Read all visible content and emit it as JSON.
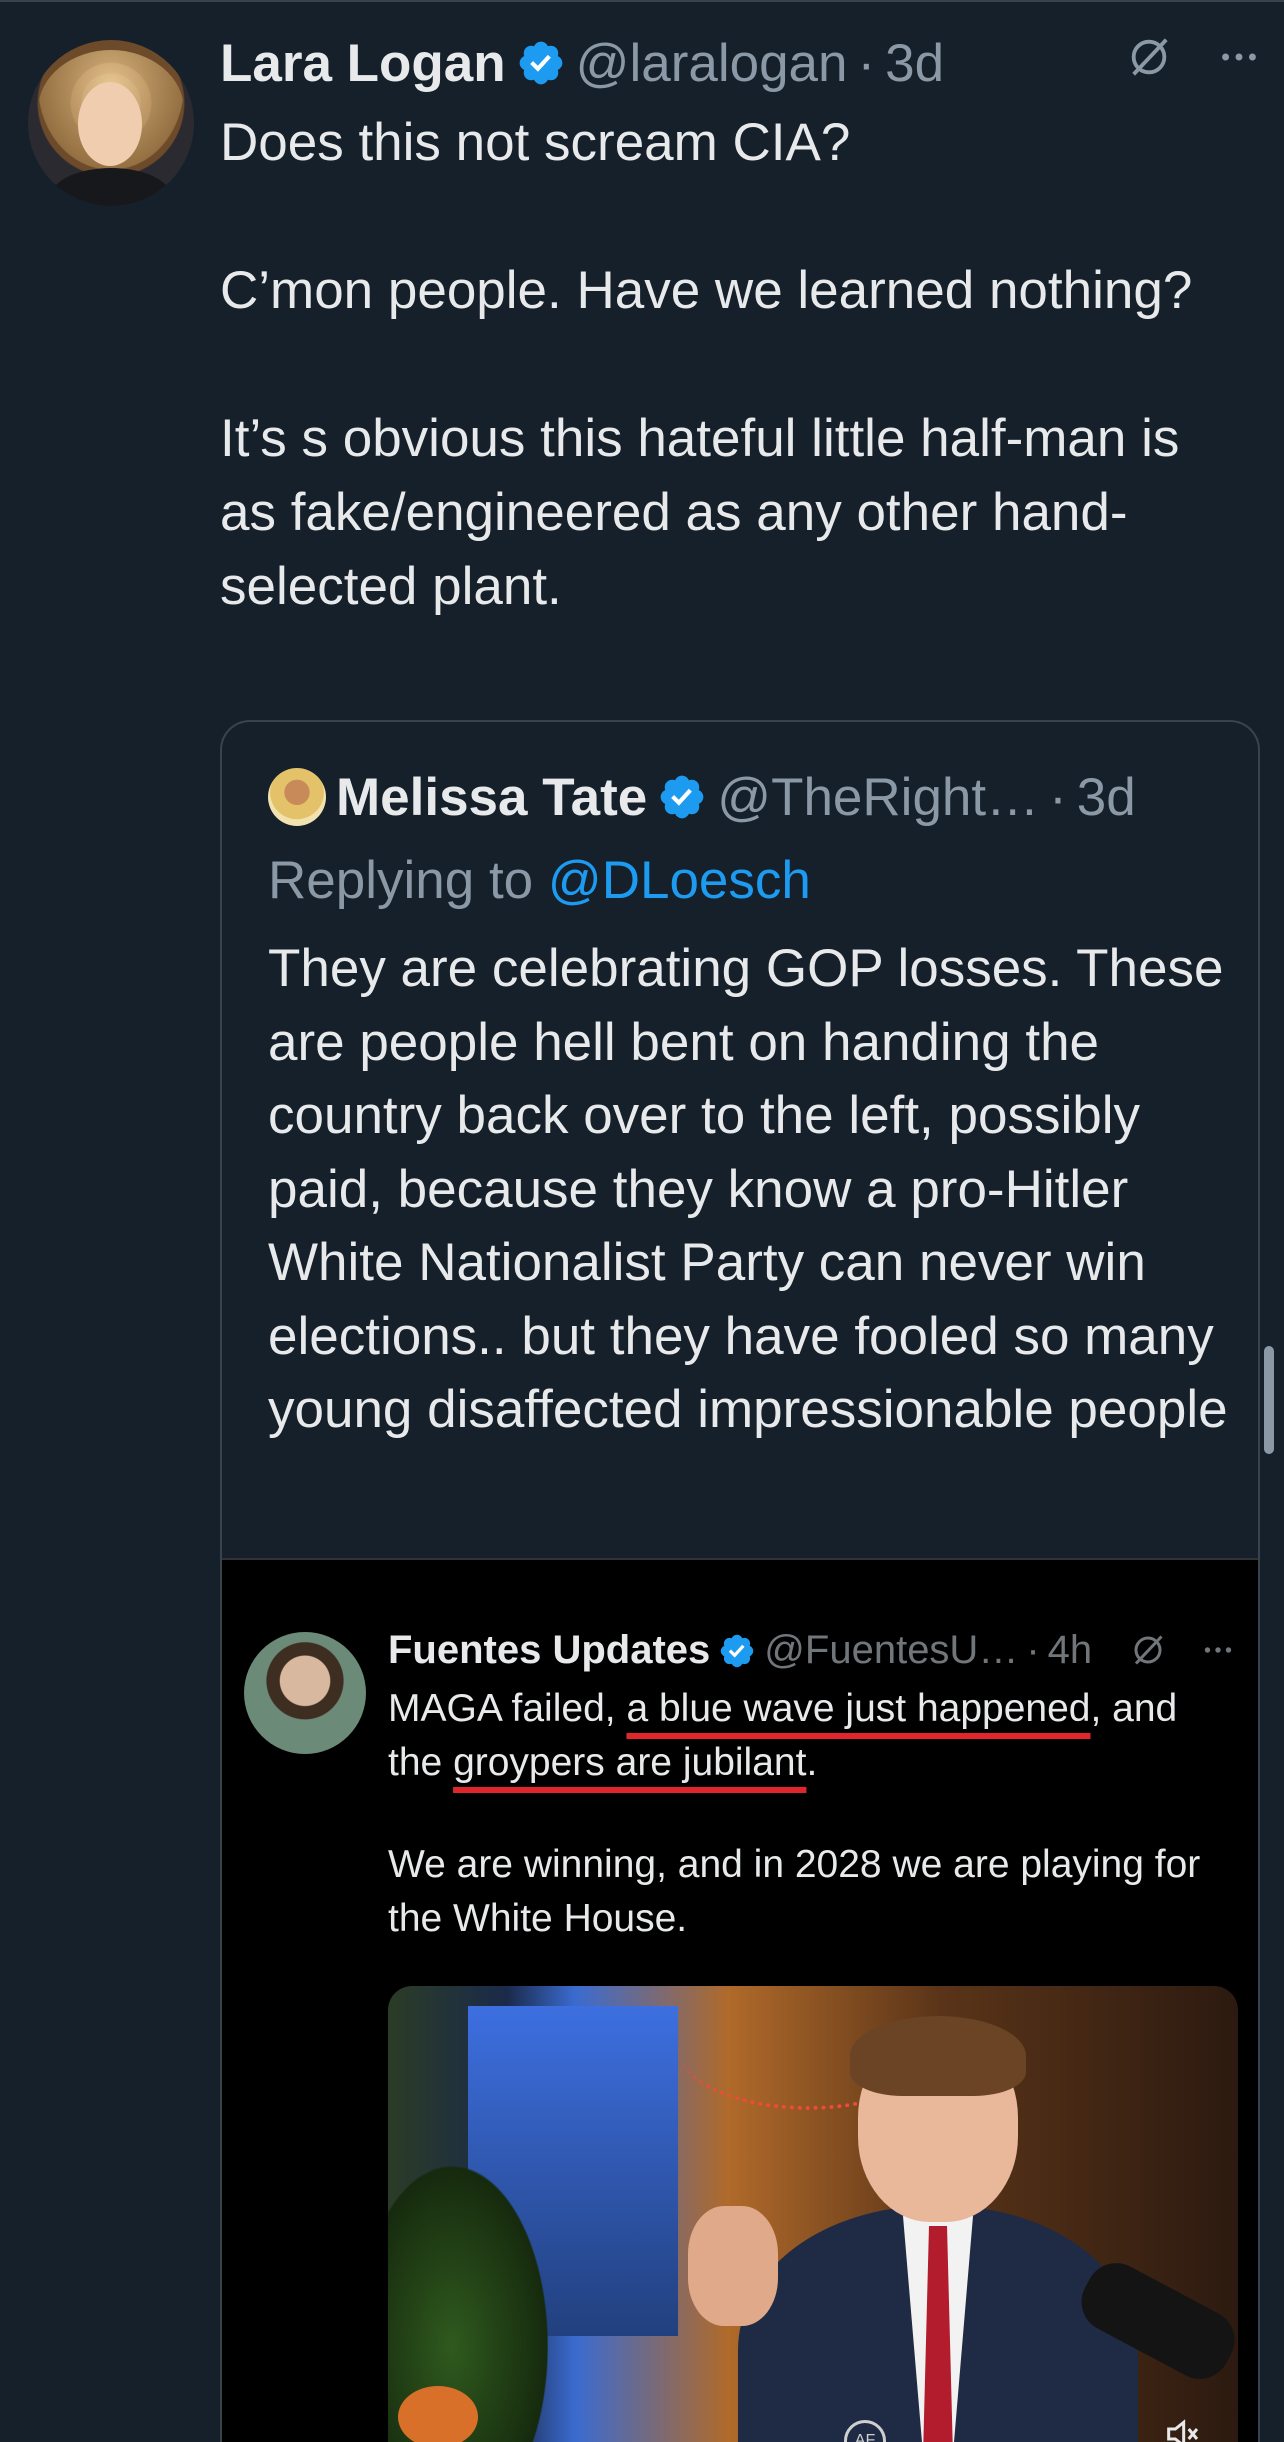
{
  "tweet": {
    "author_name": "Lara Logan",
    "author_handle": "@laralogan",
    "separator": "·",
    "time": "3d",
    "paragraphs": [
      "Does this not scream CIA?",
      "C’mon people. Have we learned nothing?",
      "It’s s obvious this hateful little half-man is as fake/engineered as any other hand-selected plant."
    ]
  },
  "quote": {
    "author_name": "Melissa Tate",
    "author_handle": "@TheRight…",
    "separator": "·",
    "time": "3d",
    "replying_prefix": "Replying to",
    "replying_mention": "@DLoesch",
    "text": "They are celebrating GOP losses. These are people hell bent on handing the country back over to the left, possibly paid, because they know a pro-Hitler White Nationalist Party can never win elections.. but they have fooled so many young disaffected impressionable people"
  },
  "embedded": {
    "author_name": "Fuentes Updates",
    "author_handle": "@FuentesU…",
    "separator": "·",
    "time": "4h",
    "line1_a": "MAGA failed, ",
    "line1_underlined": "a blue wave just happened",
    "line1_b": ", and the ",
    "line1_underlined2": "groypers are jubilant",
    "line1_c": ".",
    "paragraph2": "We are winning, and in 2028 we are playing for the White House.",
    "video_logo": "AF"
  },
  "colors": {
    "background": "#15202b",
    "text": "#e7e9ea",
    "muted": "#8b98a5",
    "link": "#1d9bf0",
    "verified": "#1d9bf0",
    "underline": "#e0262b"
  },
  "icons": {
    "grok": "slashed-circle-icon",
    "more": "more-icon",
    "verified": "verified-badge-icon",
    "mute": "volume-mute-icon"
  }
}
